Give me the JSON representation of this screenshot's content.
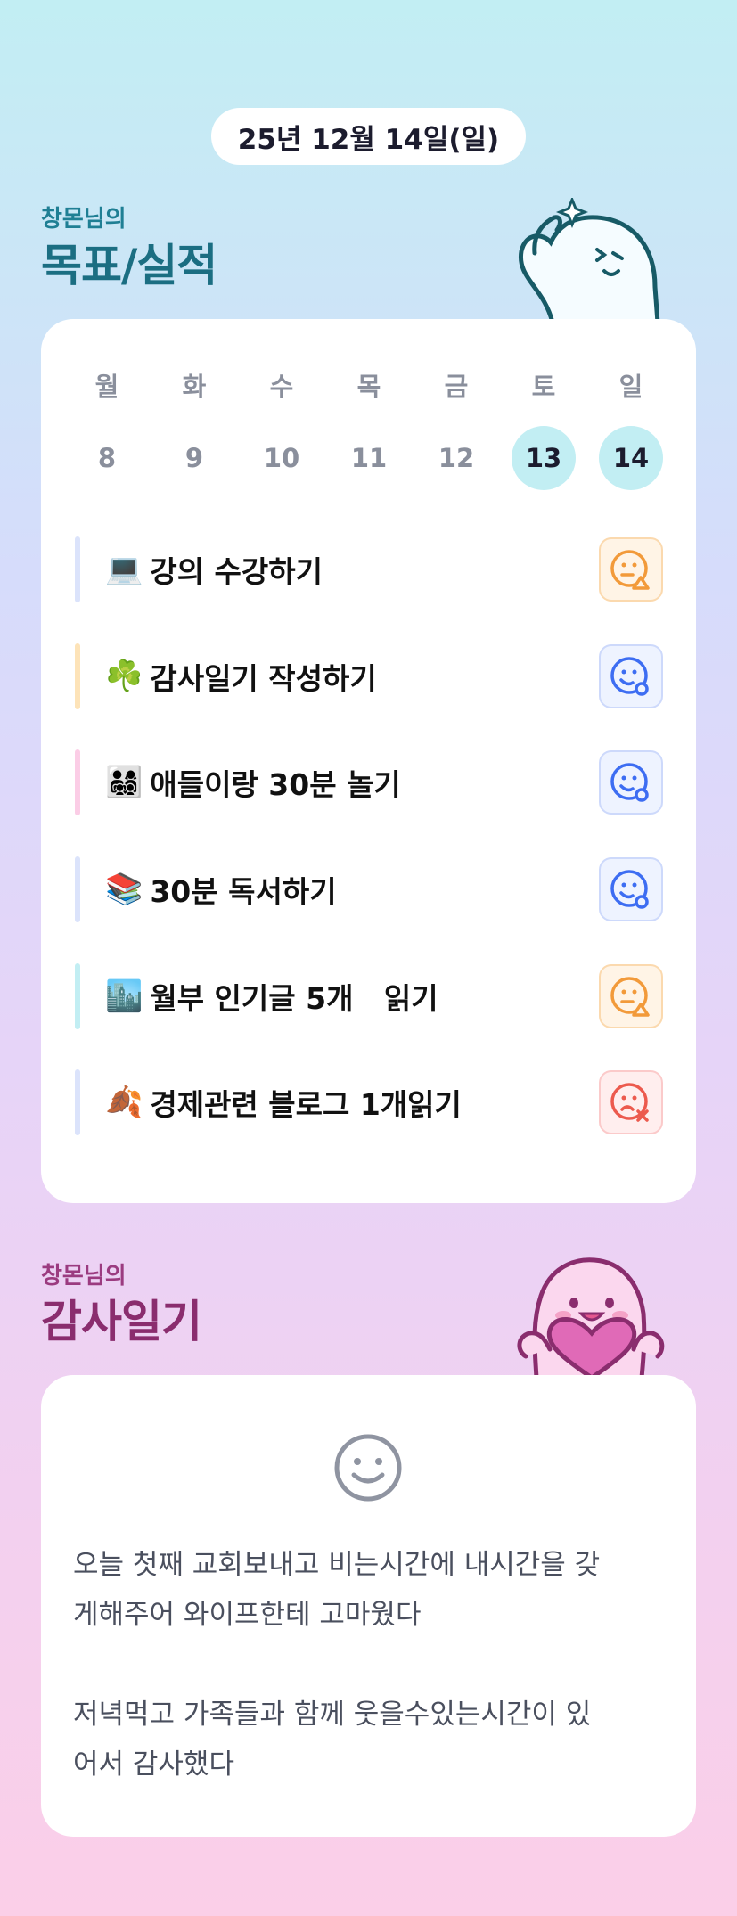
{
  "header": {
    "date_label": "25년 12월 14일(일)"
  },
  "goals_section": {
    "subtitle": "창몬님의",
    "title": "목표/실적",
    "week_days": [
      "월",
      "화",
      "수",
      "목",
      "금",
      "토",
      "일"
    ],
    "week_dates": [
      "8",
      "9",
      "10",
      "11",
      "12",
      "13",
      "14"
    ],
    "active_dates": [
      "13",
      "14"
    ],
    "items": [
      {
        "emoji": "💻",
        "label": "강의 수강하기",
        "status": "partial",
        "accent": "#dbe3fb"
      },
      {
        "emoji": "☘️",
        "label": "감사일기 작성하기",
        "status": "done",
        "accent": "#fde3b8"
      },
      {
        "emoji": "👨‍👩‍👧‍👦",
        "label": "애들이랑 30분 놀기",
        "status": "done",
        "accent": "#fbcde6"
      },
      {
        "emoji": "📚",
        "label": "30분 독서하기",
        "status": "done",
        "accent": "#dbe3fb"
      },
      {
        "emoji": "🏙️",
        "label": "월부 인기글 5개   읽기",
        "status": "partial",
        "accent": "#c2eef3"
      },
      {
        "emoji": "🍂",
        "label": "경제관련 블로그 1개읽기",
        "status": "fail",
        "accent": "#dbe3fb"
      }
    ]
  },
  "diary_section": {
    "subtitle": "창몬님의",
    "title": "감사일기",
    "mood_icon": "smile-face-icon",
    "text": "오늘 첫째 교회보내고 비는시간에 내시간을 갖\n게해주어 와이프한테 고마웠다\n\n저녁먹고 가족들과 함께 웃을수있는시간이 있\n어서 감사했다"
  },
  "colors": {
    "partial": "#f29a3a",
    "done": "#3d6df2",
    "fail": "#ec5a4e",
    "active_date": "#c2eef3"
  }
}
